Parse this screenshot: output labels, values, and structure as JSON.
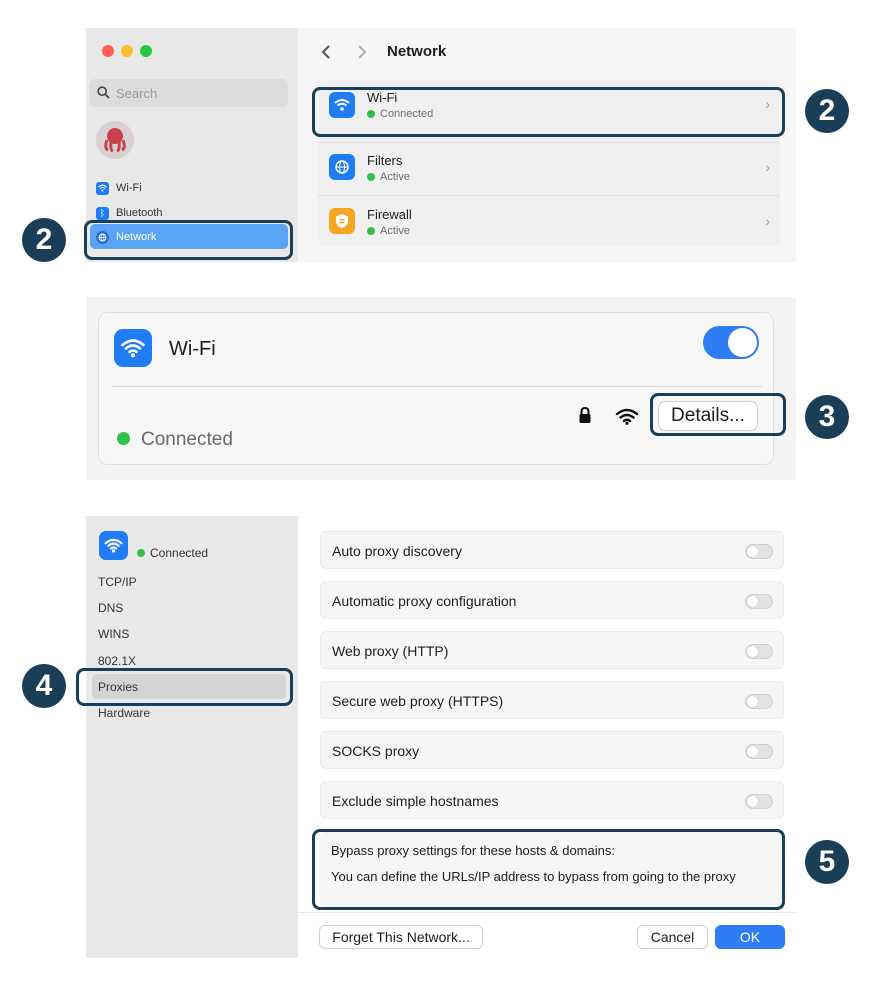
{
  "window1": {
    "title": "Network",
    "search_placeholder": "Search",
    "sidebar": [
      {
        "label": "Wi-Fi",
        "icon": "wifi-icon"
      },
      {
        "label": "Bluetooth",
        "icon": "bluetooth-icon"
      },
      {
        "label": "Network",
        "icon": "globe-icon",
        "selected": true
      }
    ],
    "rows": [
      {
        "title": "Wi-Fi",
        "status": "Connected",
        "icon": "wifi-icon",
        "color": "#1f7cf5"
      },
      {
        "title": "Filters",
        "status": "Active",
        "icon": "globe-icon",
        "color": "#1f7cf5"
      },
      {
        "title": "Firewall",
        "status": "Active",
        "icon": "shield-icon",
        "color": "#f5a623"
      }
    ]
  },
  "window2": {
    "title": "Wi-Fi",
    "toggle_on": true,
    "status": "Connected",
    "details_button": "Details..."
  },
  "window3": {
    "status": "Connected",
    "sidebar": [
      "TCP/IP",
      "DNS",
      "WINS",
      "802.1X",
      "Proxies",
      "Hardware"
    ],
    "selected": "Proxies",
    "proxy_rows": [
      {
        "label": "Auto proxy discovery",
        "on": false
      },
      {
        "label": "Automatic proxy configuration",
        "on": false
      },
      {
        "label": "Web proxy (HTTP)",
        "on": false
      },
      {
        "label": "Secure web proxy (HTTPS)",
        "on": false
      },
      {
        "label": "SOCKS proxy",
        "on": false
      },
      {
        "label": "Exclude simple hostnames",
        "on": false
      }
    ],
    "bypass_label": "Bypass proxy settings for these hosts & domains:",
    "bypass_text": "You can define the URLs/IP address to bypass from going to the proxy",
    "forget_button": "Forget This Network...",
    "cancel_button": "Cancel",
    "ok_button": "OK"
  },
  "callouts": [
    "2",
    "2",
    "3",
    "4",
    "5"
  ],
  "colors": {
    "accent": "#2e7cf6",
    "callout": "#1a3e57",
    "connected": "#2fc24a"
  }
}
